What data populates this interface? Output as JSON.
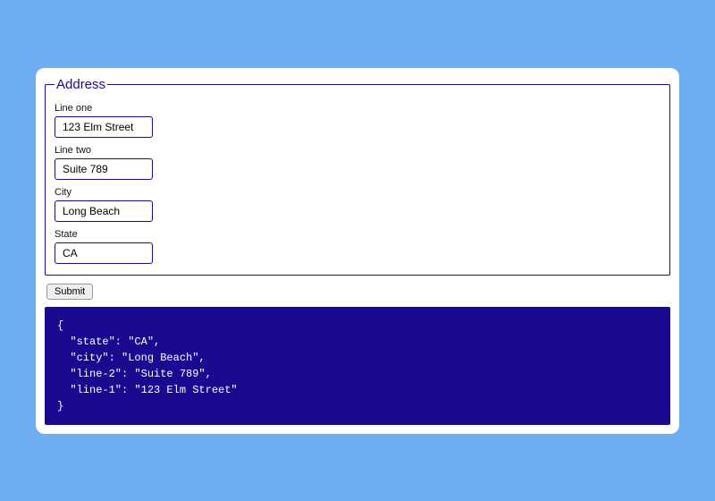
{
  "form": {
    "legend": "Address",
    "fields": {
      "line1": {
        "label": "Line one",
        "value": "123 Elm Street"
      },
      "line2": {
        "label": "Line two",
        "value": "Suite 789"
      },
      "city": {
        "label": "City",
        "value": "Long Beach"
      },
      "state": {
        "label": "State",
        "value": "CA"
      }
    },
    "submit_label": "Submit"
  },
  "output": "{\n  \"state\": \"CA\",\n  \"city\": \"Long Beach\",\n  \"line-2\": \"Suite 789\",\n  \"line-1\": \"123 Elm Street\"\n}"
}
